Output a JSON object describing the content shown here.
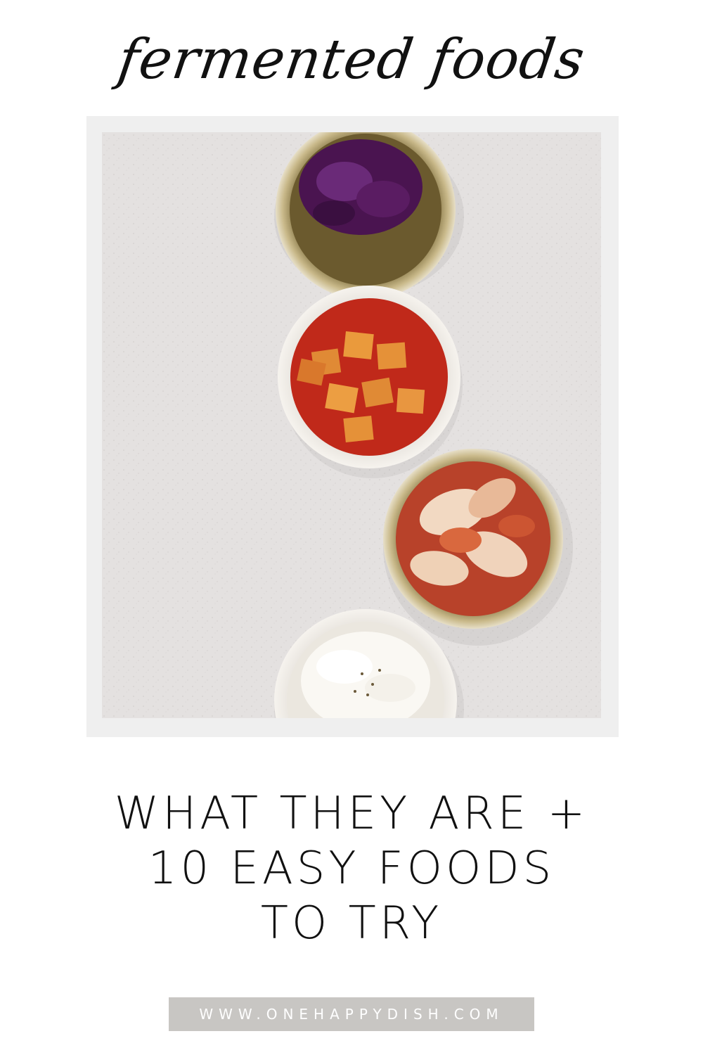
{
  "title": "fermented foods",
  "headline": {
    "line1": "WHAT THEY ARE +",
    "line2": "10 EASY FOODS",
    "line3": "TO TRY"
  },
  "website": "WWW.ONEHAPPYDISH.COM",
  "photo": {
    "bowls": [
      "red-cabbage-bowl",
      "radish-kimchi-bowl",
      "cabbage-kimchi-bowl",
      "sauerkraut-bowl"
    ]
  },
  "colors": {
    "background": "#ffffff",
    "frame": "#efefef",
    "countertop": "#e3e0df",
    "url_bar": "#c8c6c3",
    "text": "#111111"
  }
}
